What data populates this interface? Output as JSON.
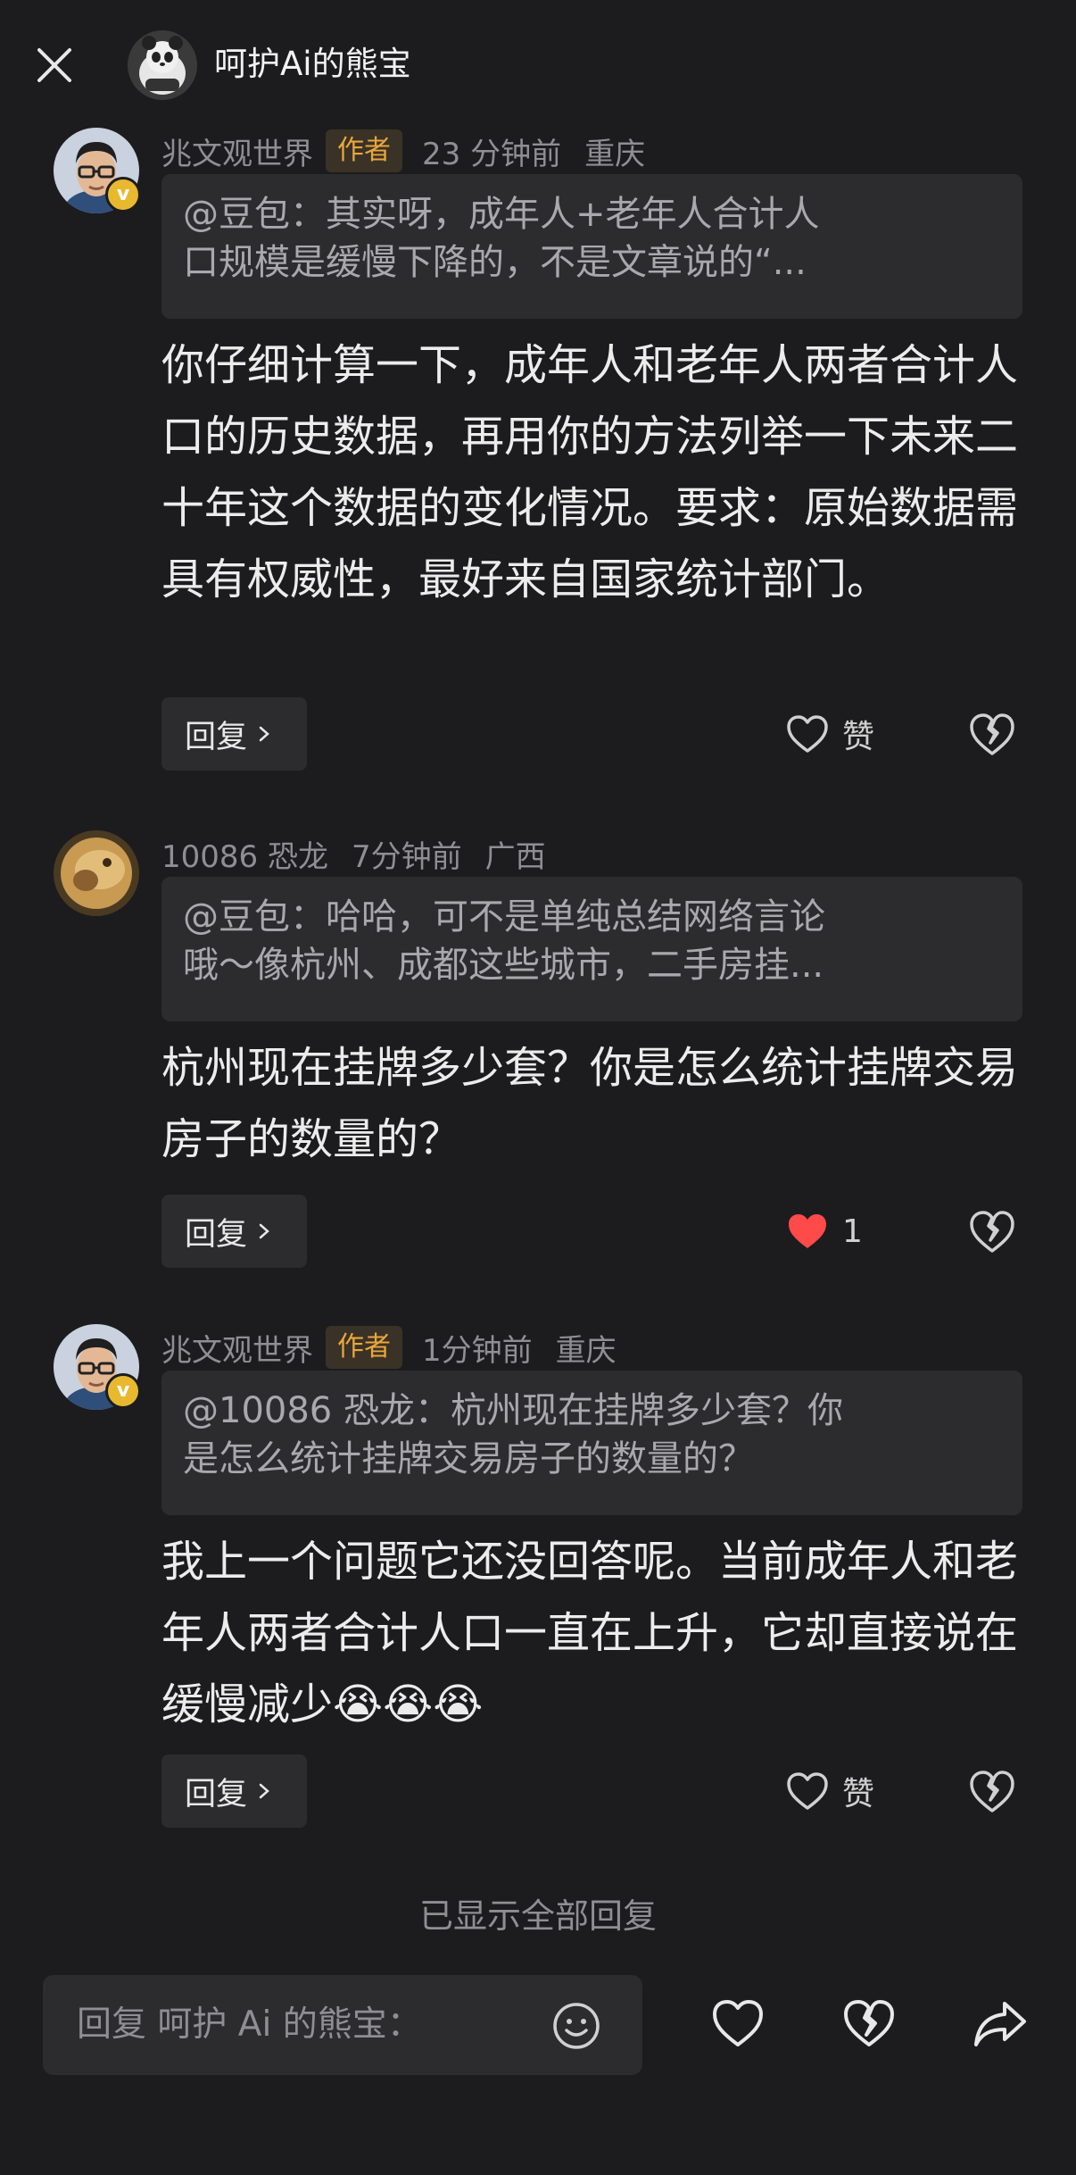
{
  "header": {
    "title": "呵护Ai的熊宝"
  },
  "comments": [
    {
      "username": "兆文观世界",
      "author_tag": "作者",
      "time": "23 分钟前",
      "location": "重庆",
      "quote_line1": "@豆包：其实呀，成年人+老年人合计人",
      "quote_line2": "口规模是缓慢下降的，不是文章说的“...",
      "body": "你仔细计算一下，成年人和老年人两者合计人口的历史数据，再用你的方法列举一下未来二十年这个数据的变化情况。要求：原始数据需具有权威性，最好来自国家统计部门。",
      "reply_label": "回复",
      "like_label": "赞"
    },
    {
      "username": "10086 恐龙",
      "time": "7分钟前",
      "location": "广西",
      "quote_line1": "@豆包：哈哈，可不是单纯总结网络言论",
      "quote_line2": "哦～像杭州、成都这些城市，二手房挂...",
      "body": "杭州现在挂牌多少套？你是怎么统计挂牌交易房子的数量的？",
      "reply_label": "回复",
      "like_label": "1"
    },
    {
      "username": "兆文观世界",
      "author_tag": "作者",
      "time": "1分钟前",
      "location": "重庆",
      "quote_line1": "@10086 恐龙：杭州现在挂牌多少套？你",
      "quote_line2": "是怎么统计挂牌交易房子的数量的？",
      "body": "我上一个问题它还没回答呢。当前成年人和老年人两者合计人口一直在上升，它却直接说在缓慢减少",
      "body_emoji": "😭😭😭",
      "reply_label": "回复",
      "like_label": "赞"
    }
  ],
  "footer_note": "已显示全部回复",
  "input": {
    "placeholder": "回复 呵护 Ai 的熊宝："
  },
  "colors": {
    "background": "#1c1c1e",
    "card": "#2c2c2e",
    "author_tag_text": "#e9a73c",
    "liked_heart": "#ff4a4a",
    "badge": "#e8b92e"
  }
}
